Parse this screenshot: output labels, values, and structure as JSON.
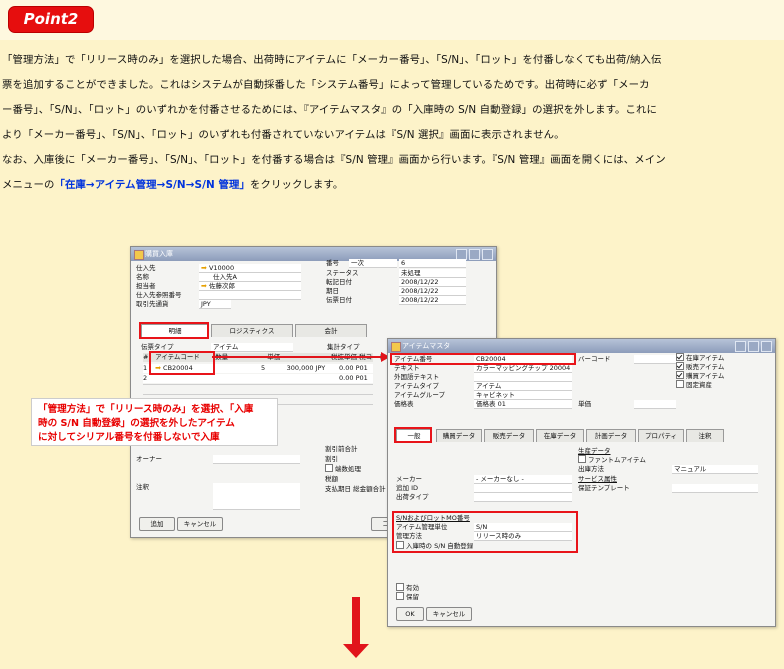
{
  "point_badge": "Point2",
  "paragraph_lines": [
    "「管理方法」で「リリース時のみ」を選択した場合、出荷時にアイテムに「メーカー番号」、「S/N」、「ロット」を付番しなくても出荷/納入伝",
    "票を追加することができました。これはシステムが自動採番した「システム番号」によって管理しているためです。出荷時に必ず「メーカ",
    "ー番号」、「S/N」、「ロット」のいずれかを付番させるためには、『アイテムマスタ』の「入庫時の S/N 自動登録」の選択を外します。これに",
    "より「メーカー番号」、「S/N」、「ロット」のいずれも付番されていないアイテムは『S/N 選択』画面に表示されません。",
    "なお、入庫後に「メーカー番号」、「S/N」、「ロット」を付番する場合は『S/N 管理』画面から行います。『S/N 管理』画面を開くには、メイン"
  ],
  "last_line_prefix": "メニューの",
  "last_line_highlight": "「在庫→アイテム管理→S/N→S/N 管理」",
  "last_line_suffix": "をクリックします。",
  "purchase_window": {
    "title": "購買入庫",
    "header_fields": [
      {
        "label": "仕入先",
        "value": "V10000",
        "arrow": true
      },
      {
        "label": "名称",
        "value": "仕入先A",
        "arrow": false
      },
      {
        "label": "担当者",
        "value": "佐藤次郎",
        "arrow": true
      },
      {
        "label": "仕入先参照番号",
        "value": "",
        "arrow": false
      },
      {
        "label": "取引先通貨",
        "value": "JPY",
        "arrow": false
      }
    ],
    "right_fields": [
      {
        "label": "番号",
        "value": "一次",
        "value2": "6"
      },
      {
        "label": "ステータス",
        "value": "未処理"
      },
      {
        "label": "転記日付",
        "value": "2008/12/22"
      },
      {
        "label": "期日",
        "value": "2008/12/22"
      },
      {
        "label": "伝票日付",
        "value": "2008/12/22"
      }
    ],
    "tabs": [
      "明細",
      "ロジスティクス",
      "会計"
    ],
    "type_label": "伝票タイプ",
    "type_value": "アイテム",
    "summary_label": "集計タイプ",
    "grid_headers": [
      "#",
      "アイテムコード",
      "数量",
      "単価",
      "税抜単価",
      "税コード"
    ],
    "grid_rows": [
      {
        "num": "1",
        "code": "CB20004",
        "qty": "5",
        "price": "300,000 JPY",
        "tax": "0.00",
        "taxcode": "P01"
      },
      {
        "num": "2",
        "code": "",
        "qty": "",
        "price": "",
        "tax": "0.00",
        "taxcode": "P01"
      }
    ],
    "owner_label": "オーナー",
    "remarks_label": "注釈",
    "discount_label": "割引前合計",
    "discount2_label": "割引",
    "rounding_label": "端数処理",
    "tax_label": "税額",
    "total_label": "支払期日 総金額合計",
    "add_button": "追加",
    "cancel_button": "キャンセル",
    "copy_button": "コピー"
  },
  "item_window": {
    "title": "アイテムマスタ",
    "fields": [
      {
        "label": "アイテム番号",
        "value": "CB20004"
      },
      {
        "label": "テキスト",
        "value": "カラーマッピングチップ 20004"
      },
      {
        "label": "外国語テキスト",
        "value": ""
      },
      {
        "label": "アイテムタイプ",
        "value": "アイテム"
      },
      {
        "label": "アイテムグループ",
        "value": "キャビネット"
      },
      {
        "label": "価格表",
        "value": "価格表 01"
      }
    ],
    "unit_price_label": "単価",
    "barcode_label": "バーコード",
    "checks": [
      {
        "label": "在庫アイテム",
        "on": true
      },
      {
        "label": "販売アイテム",
        "on": true
      },
      {
        "label": "購買アイテム",
        "on": true
      },
      {
        "label": "固定資産",
        "on": false
      }
    ],
    "tabs": [
      "一般",
      "購買データ",
      "販売データ",
      "在庫データ",
      "計画データ",
      "プロパティ",
      "注釈"
    ],
    "maker_label": "メーカー",
    "maker_value": "- メーカーなし -",
    "extra_id_label": "追加 ID",
    "shipping_type_label": "出荷タイプ",
    "production_data_label": "生産データ",
    "phantom_label": "ファントムアイテム",
    "issue_method_label": "出庫方法",
    "issue_method_value": "マニュアル",
    "service_label": "サービス属性",
    "warranty_label": "保証テンプレート",
    "serial_section_label": "S/NおよびロットMO番号",
    "mgmt_unit_label": "アイテム管理単位",
    "mgmt_unit_value": "S/N",
    "mgmt_method_label": "管理方法",
    "mgmt_method_value": "リリース時のみ",
    "auto_reg_label": "入庫時の S/N 自動登録",
    "active_label": "有効",
    "hold_label": "保留",
    "ok_button": "OK",
    "cancel_button": "キャンセル"
  },
  "callout_lines": [
    "「管理方法」で「リリース時のみ」を選択、「入庫",
    "時の S/N 自動登録」の選択を外したアイテム",
    "に対してシリアル番号を付番しないで入庫"
  ]
}
